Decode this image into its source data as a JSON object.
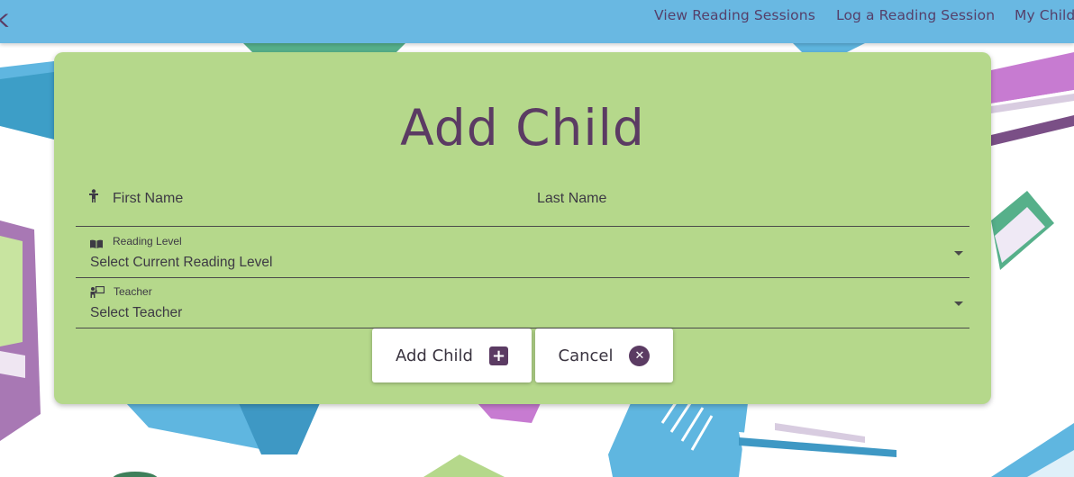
{
  "nav": {
    "brand_glyph": "k",
    "items": [
      {
        "label": "View Reading Sessions"
      },
      {
        "label": "Log a Reading Session"
      },
      {
        "label": "My Child"
      }
    ]
  },
  "form": {
    "title": "Add Child",
    "first_name_placeholder": "First Name",
    "last_name_placeholder": "Last Name",
    "reading_level_label": "Reading Level",
    "reading_level_value": "Select Current Reading Level",
    "teacher_label": "Teacher",
    "teacher_value": "Select Teacher",
    "add_button_label": "Add Child",
    "cancel_button_label": "Cancel"
  },
  "icons": {
    "first_name": "person-icon",
    "reading_level": "book-open-icon",
    "teacher": "teacher-board-icon",
    "add": "plus-box-icon",
    "cancel": "close-circle-icon",
    "dropdown": "dropdown-arrow-icon"
  },
  "colors": {
    "nav_bg": "#69b8e2",
    "card_bg": "#b5d88b",
    "accent_purple": "#5b3b63",
    "book_blue": "#5fb6e0",
    "book_purple": "#a878b4",
    "book_green": "#56b08a"
  }
}
